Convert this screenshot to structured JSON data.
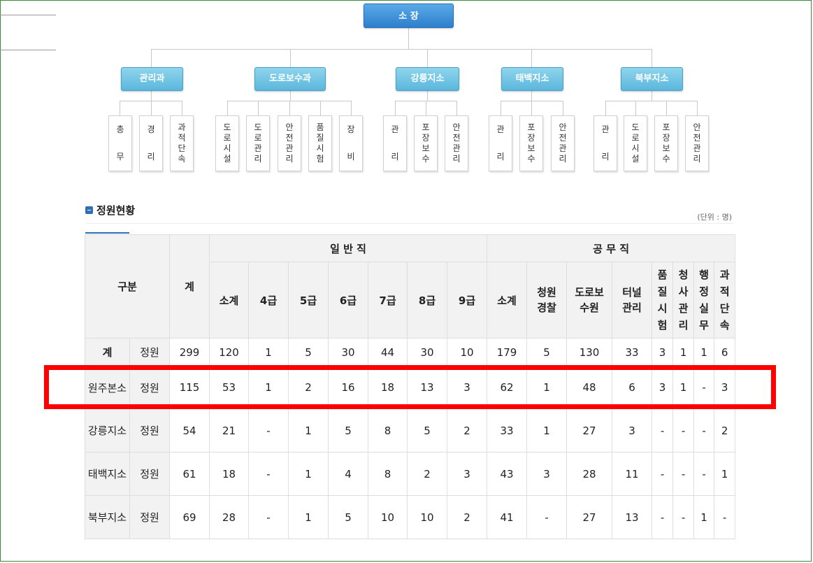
{
  "org": {
    "top": "소 장",
    "depts": [
      {
        "name": "관리과",
        "subs": [
          [
            "총",
            "무"
          ],
          [
            "경",
            "리"
          ],
          [
            "과",
            "적",
            "단",
            "속"
          ]
        ]
      },
      {
        "name": "도로보수과",
        "subs": [
          [
            "도",
            "로",
            "시",
            "설"
          ],
          [
            "도",
            "로",
            "관",
            "리"
          ],
          [
            "안",
            "전",
            "관",
            "리"
          ],
          [
            "품",
            "질",
            "시",
            "험"
          ],
          [
            "장",
            "비"
          ]
        ]
      },
      {
        "name": "강릉지소",
        "subs": [
          [
            "관",
            "리"
          ],
          [
            "포",
            "장",
            "보",
            "수"
          ],
          [
            "안",
            "전",
            "관",
            "리"
          ]
        ]
      },
      {
        "name": "태백지소",
        "subs": [
          [
            "관",
            "리"
          ],
          [
            "포",
            "장",
            "보",
            "수"
          ],
          [
            "안",
            "전",
            "관",
            "리"
          ]
        ]
      },
      {
        "name": "북부지소",
        "subs": [
          [
            "관",
            "리"
          ],
          [
            "도",
            "로",
            "시",
            "설"
          ],
          [
            "포",
            "장",
            "보",
            "수"
          ],
          [
            "안",
            "전",
            "관",
            "리"
          ]
        ]
      }
    ]
  },
  "section": {
    "title": "정원현황",
    "unit": "(단위 : 명)"
  },
  "table": {
    "h_gubun": "구분",
    "h_total": "계",
    "h_general": "일 반 직",
    "h_public": "공 무 직",
    "general_cols": [
      "소계",
      "4급",
      "5급",
      "6급",
      "7급",
      "8급",
      "9급"
    ],
    "public_cols": [
      "소계",
      "청원경찰",
      "도로보수원",
      "터널관리",
      "품질시험",
      "청사관리",
      "행정실무",
      "과적단속"
    ],
    "rows": [
      {
        "name": "계",
        "kind": "정원",
        "vals": [
          "299",
          "120",
          "1",
          "5",
          "30",
          "44",
          "30",
          "10",
          "179",
          "5",
          "130",
          "33",
          "3",
          "1",
          "1",
          "6"
        ]
      },
      {
        "name": "원주본소",
        "kind": "정원",
        "vals": [
          "115",
          "53",
          "1",
          "2",
          "16",
          "18",
          "13",
          "3",
          "62",
          "1",
          "48",
          "6",
          "3",
          "1",
          "-",
          "3"
        ]
      },
      {
        "name": "강릉지소",
        "kind": "정원",
        "vals": [
          "54",
          "21",
          "-",
          "1",
          "5",
          "8",
          "5",
          "2",
          "33",
          "1",
          "27",
          "3",
          "-",
          "-",
          "-",
          "2"
        ]
      },
      {
        "name": "태백지소",
        "kind": "정원",
        "vals": [
          "61",
          "18",
          "-",
          "1",
          "4",
          "8",
          "2",
          "3",
          "43",
          "3",
          "28",
          "11",
          "-",
          "-",
          "-",
          "1"
        ]
      },
      {
        "name": "북부지소",
        "kind": "정원",
        "vals": [
          "69",
          "28",
          "-",
          "1",
          "5",
          "10",
          "10",
          "2",
          "41",
          "-",
          "27",
          "13",
          "-",
          "-",
          "1",
          "-"
        ]
      }
    ]
  }
}
